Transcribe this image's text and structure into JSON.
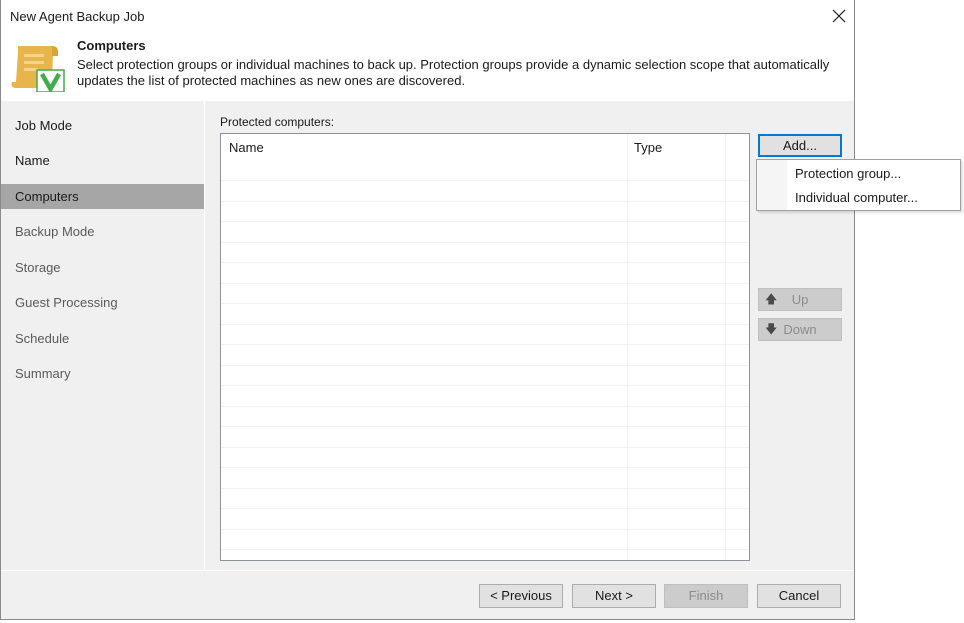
{
  "window": {
    "title": "New Agent Backup Job",
    "close_icon": "close-icon"
  },
  "header": {
    "icon": "scroll-with-checkmark-icon",
    "title": "Computers",
    "description": "Select protection groups or individual machines to back up. Protection groups provide a dynamic selection scope that automatically updates the list of protected machines as new ones are discovered."
  },
  "sidebar": {
    "items": [
      {
        "label": "Job Mode",
        "state": "done"
      },
      {
        "label": "Name",
        "state": "done"
      },
      {
        "label": "Computers",
        "state": "active"
      },
      {
        "label": "Backup Mode",
        "state": "pending"
      },
      {
        "label": "Storage",
        "state": "pending"
      },
      {
        "label": "Guest Processing",
        "state": "pending"
      },
      {
        "label": "Schedule",
        "state": "pending"
      },
      {
        "label": "Summary",
        "state": "pending"
      }
    ]
  },
  "main": {
    "list_label": "Protected computers:",
    "columns": [
      "Name",
      "Type"
    ],
    "rows": []
  },
  "buttons": {
    "add": "Add...",
    "up": "Up",
    "down": "Down",
    "up_icon": "arrow-up-icon",
    "down_icon": "arrow-down-icon"
  },
  "add_menu": {
    "items": [
      "Protection group...",
      "Individual computer..."
    ]
  },
  "footer": {
    "previous": "< Previous",
    "next": "Next >",
    "finish": "Finish",
    "cancel": "Cancel"
  },
  "colors": {
    "accent_focus": "#0078d7",
    "active_step_bg": "#a6a6a6",
    "icon_scroll": "#e8b54a",
    "icon_check": "#3fae49"
  }
}
